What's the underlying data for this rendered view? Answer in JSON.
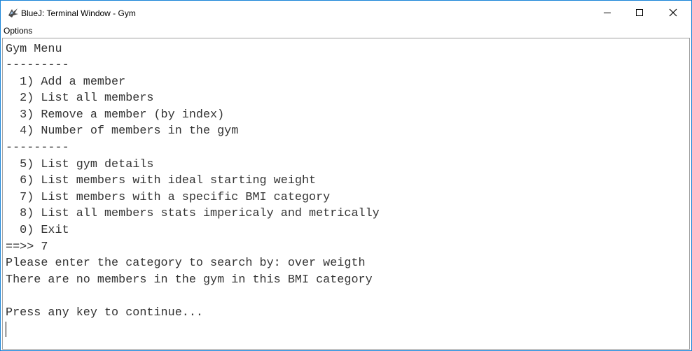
{
  "window": {
    "title": "BlueJ: Terminal Window - Gym",
    "icon": "bluej-bird-icon",
    "controls": [
      "minimize",
      "maximize",
      "close"
    ],
    "border_color": "#1883d7"
  },
  "menubar": {
    "items": [
      "Options"
    ]
  },
  "terminal": {
    "lines": [
      "Gym Menu",
      "---------",
      "  1) Add a member",
      "  2) List all members",
      "  3) Remove a member (by index)",
      "  4) Number of members in the gym",
      "---------",
      "  5) List gym details",
      "  6) List members with ideal starting weight",
      "  7) List members with a specific BMI category",
      "  8) List all members stats impericaly and metrically",
      "  0) Exit",
      "==>> 7",
      "Please enter the category to search by: over weigth",
      "There are no members in the gym in this BMI category",
      "",
      "Press any key to continue..."
    ]
  }
}
